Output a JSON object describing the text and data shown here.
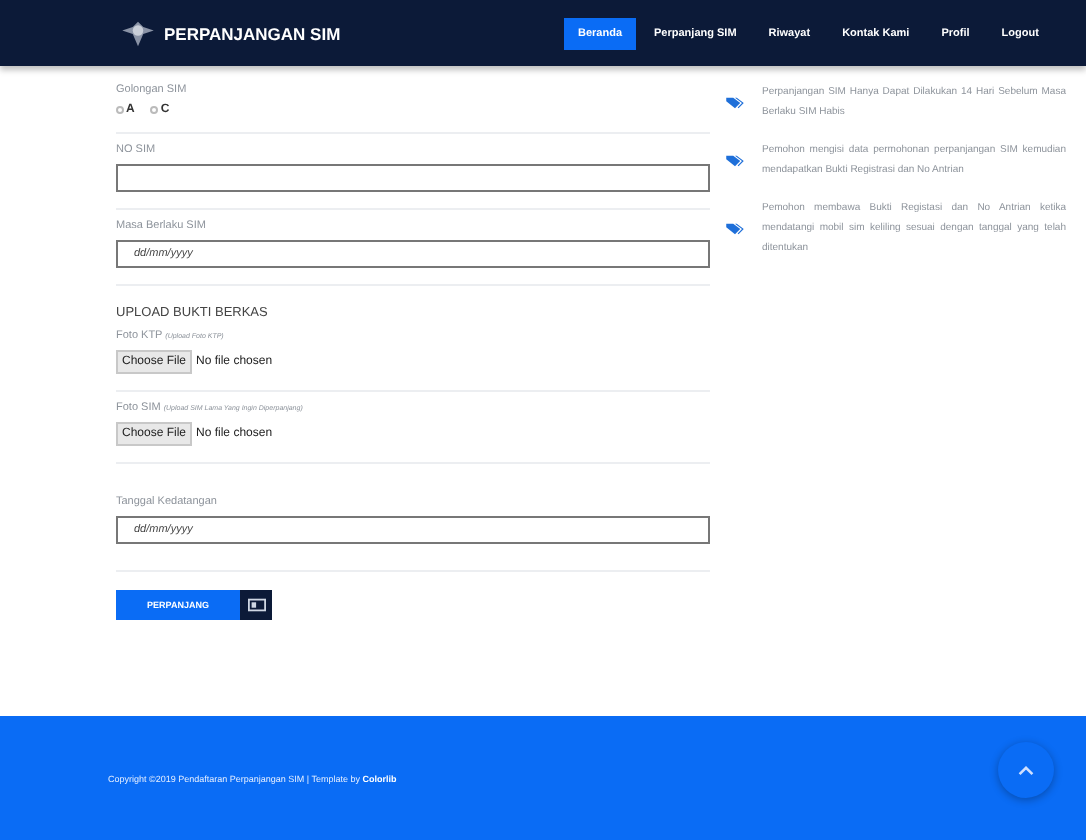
{
  "navbar": {
    "brand": "PERPANJANGAN SIM",
    "items": [
      {
        "label": "Beranda",
        "selected": true
      },
      {
        "label": "Perpanjang SIM",
        "selected": false
      },
      {
        "label": "Riwayat",
        "selected": false
      },
      {
        "label": "Kontak Kami",
        "selected": false
      },
      {
        "label": "Profil",
        "selected": false
      },
      {
        "label": "Logout",
        "selected": false
      }
    ]
  },
  "form": {
    "golongan": {
      "label": "Golongan SIM",
      "options": [
        {
          "label": "A",
          "selected": false
        },
        {
          "label": "C",
          "selected": false
        }
      ]
    },
    "no_sim": {
      "label": "NO SIM"
    },
    "masa_berlaku": {
      "label": "Masa Berlaku SIM",
      "placeholder": "dd/mm/yyyy"
    },
    "upload_heading": "UPLOAD BUKTI BERKAS",
    "files": [
      {
        "label": "Foto KTP",
        "hint": "(Upload Foto KTP)",
        "button": "Choose File",
        "status": "No file chosen"
      },
      {
        "label": "Foto SIM",
        "hint": "(Upload SIM Lama Yang Ingin Diperpanjang)",
        "button": "Choose File",
        "status": "No file chosen"
      }
    ],
    "tanggal": {
      "label": "Tanggal Kedatangan",
      "placeholder": "dd/mm/yyyy"
    },
    "submit": "PERPANJANG"
  },
  "info": [
    "Perpanjangan SIM Hanya Dapat Dilakukan 14 Hari Sebelum Masa Berlaku SIM Habis",
    "Pemohon mengisi data permohonan perpanjangan SIM kemudian mendapatkan Bukti Registrasi dan No Antrian",
    "Pemohon membawa Bukti Registasi dan No Antrian ketika mendatangi mobil sim keliling sesuai dengan tanggal yang telah ditentukan"
  ],
  "footer": {
    "text": "Copyright ©2019 Pendaftaran Perpanjangan SIM | Template by ",
    "link": "Colorlib"
  }
}
